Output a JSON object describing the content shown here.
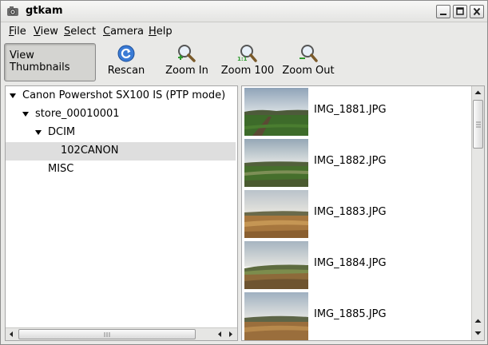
{
  "window": {
    "title": "gtkam"
  },
  "menu": {
    "items": [
      {
        "label": "File",
        "mnemonic": "F",
        "rest": "ile"
      },
      {
        "label": "View",
        "mnemonic": "V",
        "rest": "iew"
      },
      {
        "label": "Select",
        "mnemonic": "S",
        "rest": "elect"
      },
      {
        "label": "Camera",
        "mnemonic": "C",
        "rest": "amera"
      },
      {
        "label": "Help",
        "mnemonic": "H",
        "rest": "elp"
      }
    ]
  },
  "toolbar": {
    "view_thumbnails": "View Thumbnails",
    "view_thumbnails_active": true,
    "rescan": "Rescan",
    "zoom_in": "Zoom In",
    "zoom_100": "Zoom 100",
    "zoom_100_badge": "1:1",
    "zoom_out": "Zoom Out"
  },
  "tree": {
    "nodes": [
      {
        "label": "Canon Powershot SX100 IS (PTP mode)",
        "expanded": true,
        "selected": false
      },
      {
        "label": "store_00010001",
        "expanded": true,
        "selected": false
      },
      {
        "label": "DCIM",
        "expanded": true,
        "selected": false
      },
      {
        "label": "102CANON",
        "expanded": false,
        "selected": true
      },
      {
        "label": "MISC",
        "expanded": false,
        "selected": false
      }
    ]
  },
  "thumbnails": {
    "items": [
      {
        "name": "IMG_1881.JPG",
        "icon": "photo-field-track"
      },
      {
        "name": "IMG_1882.JPG",
        "icon": "photo-field-track"
      },
      {
        "name": "IMG_1883.JPG",
        "icon": "photo-plowed-field"
      },
      {
        "name": "IMG_1884.JPG",
        "icon": "photo-hillside-field"
      },
      {
        "name": "IMG_1885.JPG",
        "icon": "photo-plowed-field"
      }
    ]
  },
  "colors": {
    "window_bg": "#e9e9e7",
    "selection_bg": "#dedede",
    "rescan_blue": "#3a7bd5",
    "zoom_green": "#2e9a2e"
  }
}
